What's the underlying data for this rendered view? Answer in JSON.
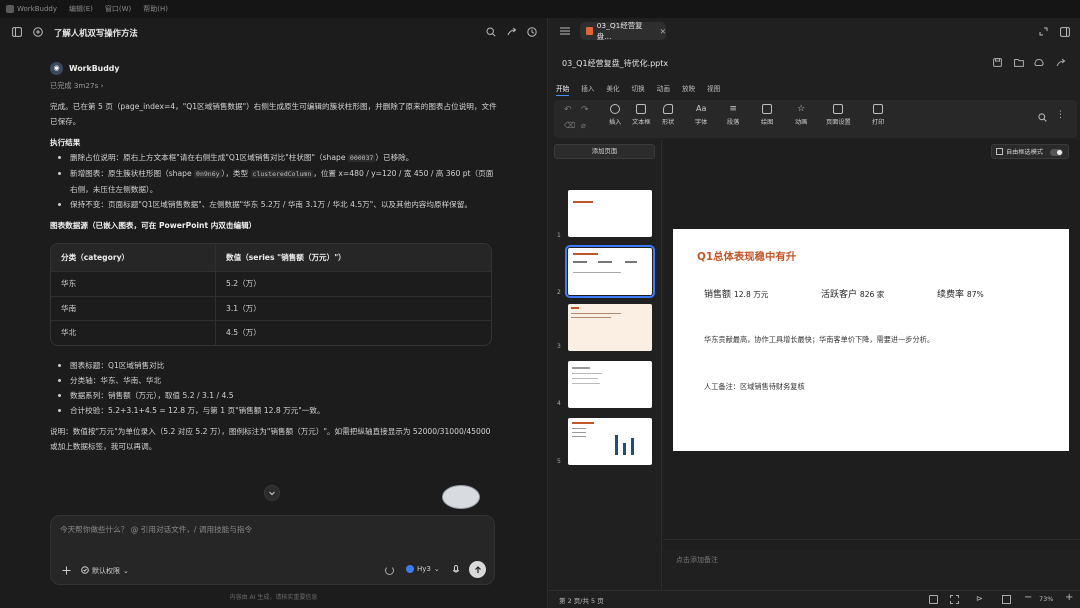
{
  "titlebar": {
    "app_name": "WorkBuddy",
    "menus": [
      "编辑(E)",
      "窗口(W)",
      "帮助(H)"
    ]
  },
  "chat": {
    "title": "了解人机双写操作方法",
    "sender": "WorkBuddy",
    "status": "已完成 3m27s",
    "summary": "完成。已在第 5 页（page_index=4，\"Q1区域销售数据\"）右侧生成原生可编辑的簇状柱形图，并删除了原来的图表占位说明，文件已保存。",
    "exec_heading": "执行结果",
    "exec_items": [
      {
        "a": "删除占位说明：原右上方文本框\"请在右侧生成\"Q1区域销售对比\"柱状图\"（shape ",
        "code": "000037",
        "b": "）已移除。"
      },
      {
        "a": "新增图表：原生簇状柱形图（shape ",
        "code": "0n9n6y",
        "b": "），类型 ",
        "code2": "clusteredColumn",
        "c": "，位置 x=480 / y=120 / 宽 450 / 高 360 pt（页面右侧，未压住左侧数据）。"
      },
      {
        "a": "保持不变：页面标题\"Q1区域销售数据\"、左侧数据\"华东 5.2万 / 华南 3.1万 / 华北 4.5万\"、以及其他内容均原样保留。"
      }
    ],
    "source_heading": "图表数据源（已嵌入图表，可在 PowerPoint 内双击编辑）",
    "table": {
      "headers": [
        "分类（category）",
        "数值（series \"销售额（万元）\"）"
      ],
      "rows": [
        [
          "华东",
          "5.2（万）"
        ],
        [
          "华南",
          "3.1（万）"
        ],
        [
          "华北",
          "4.5（万）"
        ]
      ]
    },
    "facts": [
      "图表标题：Q1区域销售对比",
      "分类轴：华东、华南、华北",
      "数据系列：销售额（万元），取值 5.2 / 3.1 / 4.5",
      "合计校验：5.2+3.1+4.5 = 12.8 万，与第 1 页\"销售额 12.8 万元\"一致。"
    ],
    "note": "说明：数值按\"万元\"为单位录入（5.2 对应 5.2 万），图例标注为\"销售额（万元）\"。如需把纵轴直接显示为 52000/31000/45000 或加上数据标签，我可以再调。",
    "input_placeholder": "今天帮你做些什么？ @ 引用对话文件，/ 调用技能与指令",
    "permission_label": "默认权限",
    "model_label": "Hy3",
    "footer": "内容由 AI 生成，请核实重要信息"
  },
  "doc": {
    "tab_label": "03_Q1经营复盘…",
    "file_name": "03_Q1经营复盘_待优化.pptx",
    "ribbon_tabs": [
      "开始",
      "插入",
      "美化",
      "切换",
      "动画",
      "放映",
      "视图"
    ],
    "ribbon_buttons": [
      "插入",
      "文本框",
      "形状",
      "字体",
      "段落",
      "绘图",
      "动画",
      "页面设置",
      "打印"
    ],
    "add_page": "添加页面",
    "free_frame": "自由框选模式",
    "slide_numbers": [
      "1",
      "2",
      "3",
      "4",
      "5"
    ],
    "slide": {
      "title": "Q1总体表现稳中有升",
      "m1_label": "销售额",
      "m1_value": "12.8 万元",
      "m2_label": "活跃客户",
      "m2_value": "826 家",
      "m3_label": "续费率",
      "m3_value": "87%",
      "body": "华东贡献最高，协作工具增长最快；华南客单价下降，需要进一步分析。",
      "note": "人工备注：区域销售待财务复核"
    },
    "notes_placeholder": "点击添加备注",
    "page_status": "第 2 页/共 5 页",
    "zoom": "73%"
  }
}
